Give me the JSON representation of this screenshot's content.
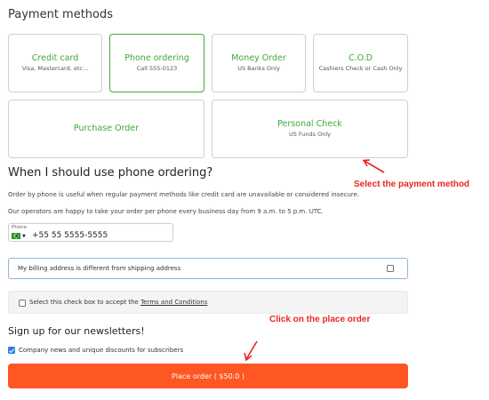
{
  "payment": {
    "title": "Payment methods",
    "methods": [
      {
        "title": "Credit card",
        "sub": "Visa, Mastercard, etc..."
      },
      {
        "title": "Phone ordering",
        "sub": "Call 555-0123",
        "selected": true
      },
      {
        "title": "Money Order",
        "sub": "US Banks Only"
      },
      {
        "title": "C.O.D",
        "sub": "Cashiers Check or Cash Only"
      },
      {
        "title": "Purchase Order",
        "sub": ""
      },
      {
        "title": "Personal Check",
        "sub": "US Funds Only"
      }
    ]
  },
  "info": {
    "title": "When I should use phone ordering?",
    "p1": "Order by phone is useful when regular payment methods like credit card are unavailable or considered insecure.",
    "p2": "Our operators are happy to take your order per phone every business day from 9 a.m. to 5 p.m. UTC."
  },
  "phone": {
    "label": "Phone",
    "value": "+55 55 5555-5555"
  },
  "billing": {
    "label": "My billing address is different from shipping address"
  },
  "terms": {
    "prefix": "Select this check box to accept the ",
    "link": "Terms and Conditions"
  },
  "newsletter": {
    "title": "Sign up for our newsletters!",
    "option": "Company news and unique discounts for subscribers"
  },
  "order": {
    "button": "Place order ( $50.0 )"
  },
  "annotations": {
    "select_payment": "Select the payment method",
    "place_order": "Click on the place order"
  },
  "colors": {
    "accent_green": "#3fa83a",
    "button_orange": "#ff5722",
    "annotation_red": "#e8271f",
    "checkbox_blue": "#2f7be0"
  }
}
